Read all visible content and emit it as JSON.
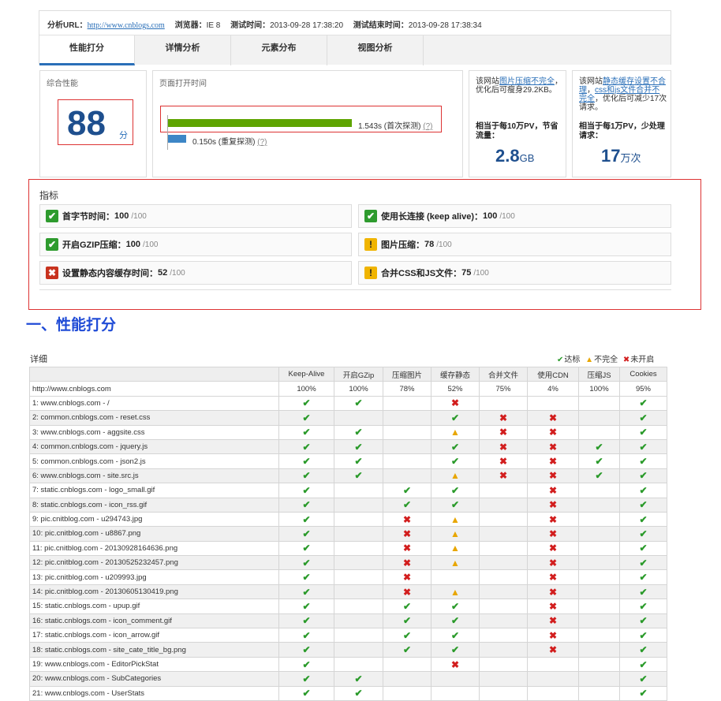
{
  "info": {
    "url_label": "分析URL：",
    "url_value": "http://www.cnblogs.com",
    "browser_label": "浏览器：",
    "browser_value": "IE 8",
    "test_time_label": "测试时间：",
    "test_time_value": "2013-09-28 17:38:20",
    "end_time_label": "测试结束时间：",
    "end_time_value": "2013-09-28 17:38:34"
  },
  "tabs": [
    "性能打分",
    "详情分析",
    "元素分布",
    "视图分析"
  ],
  "summary": {
    "overall_label": "综合性能",
    "score": "88",
    "score_unit": "分",
    "load_label": "页面打开时间",
    "first_time": "1.543s (首次探测)",
    "repeat_time": "0.150s (重复探测)",
    "help": "(?)",
    "first_fraction": 1.0,
    "repeat_fraction": 0.097,
    "note1_pre": "该网站",
    "note1_link": "图片压缩不完全",
    "note1_post": "，优化后可瘦身29.2KB。",
    "stat1_head": "相当于每10万PV，节省流量：",
    "stat1_value": "2.8",
    "stat1_unit": "GB",
    "note2_pre": "该网站",
    "note2_link1": "静态缓存设置不合理",
    "note2_sep": "，",
    "note2_link2": "css和js文件合并不完全",
    "note2_post": "，优化后可减少17次请求。",
    "stat2_head": "相当于每1万PV，少处理请求：",
    "stat2_value": "17",
    "stat2_unit": "万次"
  },
  "metrics": {
    "title": "指标",
    "items": [
      {
        "status": "ok",
        "name": "首字节时间：",
        "score": "100",
        "max": "/100"
      },
      {
        "status": "ok",
        "name": "使用长连接 (keep alive)：",
        "score": "100",
        "max": "/100"
      },
      {
        "status": "ok",
        "name": "开启GZIP压缩：",
        "score": "100",
        "max": "/100"
      },
      {
        "status": "warn",
        "name": "图片压缩：",
        "score": "78",
        "max": "/100"
      },
      {
        "status": "bad",
        "name": "设置静态内容缓存时间：",
        "score": "52",
        "max": "/100"
      },
      {
        "status": "warn",
        "name": "合并CSS和JS文件：",
        "score": "75",
        "max": "/100"
      }
    ]
  },
  "section_title": "一、性能打分",
  "detail": {
    "label": "详细",
    "legend": {
      "ok": "达标",
      "warn": "不完全",
      "bad": "未开启"
    },
    "columns": [
      "",
      "Keep-Alive",
      "开启GZip",
      "压缩图片",
      "缓存静态",
      "合并文件",
      "使用CDN",
      "压缩JS",
      "Cookies"
    ],
    "summary_row": [
      "http://www.cnblogs.com",
      "100%",
      "100%",
      "78%",
      "52%",
      "75%",
      "4%",
      "100%",
      "95%"
    ],
    "rows": [
      [
        "1: www.cnblogs.com - /",
        "ok",
        "ok",
        "",
        "bad",
        "",
        "",
        "",
        "ok"
      ],
      [
        "2: common.cnblogs.com - reset.css",
        "ok",
        "",
        "",
        "ok",
        "bad",
        "bad",
        "",
        "ok"
      ],
      [
        "3: www.cnblogs.com - aggsite.css",
        "ok",
        "ok",
        "",
        "warn",
        "bad",
        "bad",
        "",
        "ok"
      ],
      [
        "4: common.cnblogs.com - jquery.js",
        "ok",
        "ok",
        "",
        "ok",
        "bad",
        "bad",
        "ok",
        "ok"
      ],
      [
        "5: common.cnblogs.com - json2.js",
        "ok",
        "ok",
        "",
        "ok",
        "bad",
        "bad",
        "ok",
        "ok"
      ],
      [
        "6: www.cnblogs.com - site.src.js",
        "ok",
        "ok",
        "",
        "warn",
        "bad",
        "bad",
        "ok",
        "ok"
      ],
      [
        "7: static.cnblogs.com - logo_small.gif",
        "ok",
        "",
        "ok",
        "ok",
        "",
        "bad",
        "",
        "ok"
      ],
      [
        "8: static.cnblogs.com - icon_rss.gif",
        "ok",
        "",
        "ok",
        "ok",
        "",
        "bad",
        "",
        "ok"
      ],
      [
        "9: pic.cnitblog.com - u294743.jpg",
        "ok",
        "",
        "bad",
        "warn",
        "",
        "bad",
        "",
        "ok"
      ],
      [
        "10: pic.cnitblog.com - u8867.png",
        "ok",
        "",
        "bad",
        "warn",
        "",
        "bad",
        "",
        "ok"
      ],
      [
        "11: pic.cnitblog.com - 20130928164636.png",
        "ok",
        "",
        "bad",
        "warn",
        "",
        "bad",
        "",
        "ok"
      ],
      [
        "12: pic.cnitblog.com - 20130525232457.png",
        "ok",
        "",
        "bad",
        "warn",
        "",
        "bad",
        "",
        "ok"
      ],
      [
        "13: pic.cnitblog.com - u209993.jpg",
        "ok",
        "",
        "bad",
        "",
        "",
        "bad",
        "",
        "ok"
      ],
      [
        "14: pic.cnitblog.com - 20130605130419.png",
        "ok",
        "",
        "bad",
        "warn",
        "",
        "bad",
        "",
        "ok"
      ],
      [
        "15: static.cnblogs.com - upup.gif",
        "ok",
        "",
        "ok",
        "ok",
        "",
        "bad",
        "",
        "ok"
      ],
      [
        "16: static.cnblogs.com - icon_comment.gif",
        "ok",
        "",
        "ok",
        "ok",
        "",
        "bad",
        "",
        "ok"
      ],
      [
        "17: static.cnblogs.com - icon_arrow.gif",
        "ok",
        "",
        "ok",
        "ok",
        "",
        "bad",
        "",
        "ok"
      ],
      [
        "18: static.cnblogs.com - site_cate_title_bg.png",
        "ok",
        "",
        "ok",
        "ok",
        "",
        "bad",
        "",
        "ok"
      ],
      [
        "19: www.cnblogs.com - EditorPickStat",
        "ok",
        "",
        "",
        "bad",
        "",
        "",
        "",
        "ok"
      ],
      [
        "20: www.cnblogs.com - SubCategories",
        "ok",
        "ok",
        "",
        "",
        "",
        "",
        "",
        "ok"
      ],
      [
        "21: www.cnblogs.com - UserStats",
        "ok",
        "ok",
        "",
        "",
        "",
        "",
        "",
        "ok"
      ]
    ]
  },
  "colors": {
    "ok": "#2a9a2a",
    "bad": "#d21e1e",
    "warn": "#e8a600",
    "accent": "#1e4f8e",
    "bar": "#5ea400",
    "bar2": "#3d86c6"
  }
}
